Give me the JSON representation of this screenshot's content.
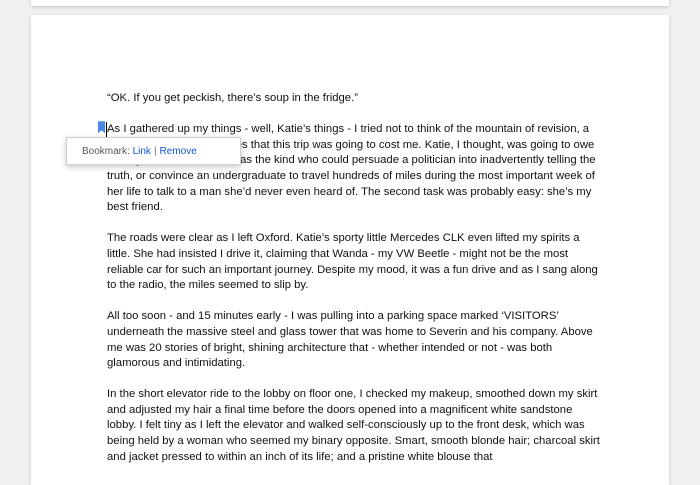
{
  "bookmark_bubble": {
    "prefix": "Bookmark:",
    "link_label": "Link",
    "separator": "|",
    "remove_label": "Remove"
  },
  "colors": {
    "bookmark_marker": "#4a86e8",
    "link": "#1155cc"
  },
  "document": {
    "paragraphs": [
      "“OK. If you get peckish, there’s soup in the fridge.”",
      "As I gathered up my things - well, Katie’s things - I tried not to think of the mountain of revision, a mountain of missed lectures that this trip was going to cost me. Katie, I thought, was going to owe me big time for this. She was the kind who could persuade a politician into inadvertently telling the truth, or convince an undergraduate to travel hundreds of miles during the most important week of her life to talk to a man she’d never even heard of. The second task was probably easy: she’s my best friend.",
      "The roads were clear as I left Oxford. Katie’s sporty little Mercedes CLK even lifted my spirits a little. She had insisted I drive it, claiming that Wanda - my VW Beetle - might not be the most reliable car for such an important journey. Despite my mood, it was a fun drive and as I sang along to the radio, the miles seemed to slip by.",
      "All too soon - and 15 minutes early - I was pulling into a parking space marked ‘VISITORS’ underneath the massive steel and glass tower that was home to Severin and his company. Above me was 20 stories of bright, shining architecture that - whether intended or not - was both glamorous and intimidating.",
      "In the short elevator ride to the lobby on floor one, I checked my makeup, smoothed down my skirt and adjusted my hair a final time before the doors opened into a magnificent white sandstone lobby. I felt tiny as I left the elevator and walked self-consciously up to the front desk, which was being held by a woman who seemed my binary opposite. Smart, smooth blonde hair; charcoal skirt and jacket pressed to within an inch of its life; and a pristine white blouse that"
    ]
  }
}
